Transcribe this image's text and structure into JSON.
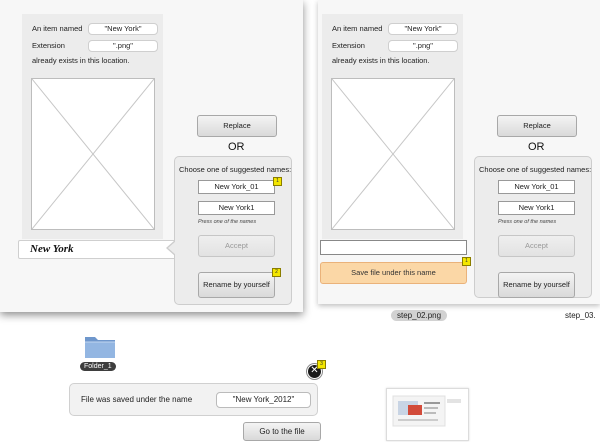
{
  "dialog_left": {
    "item_named_label": "An item named",
    "item_name_value": "\"New York\"",
    "extension_label": "Extension",
    "extension_value": "\".png\"",
    "exists_text": "already exists in this location.",
    "replace_button": "Replace",
    "or_text": "OR",
    "suggest_title": "Choose one of suggested names:",
    "suggestions": [
      "New York_01",
      "New York1"
    ],
    "hint_text": "Press one of the names",
    "accept_button": "Accept",
    "rename_button": "Rename by yourself",
    "name_field_value": "New York",
    "marker_1": "1",
    "marker_2": "2"
  },
  "dialog_right": {
    "item_named_label": "An item named",
    "item_name_value": "\"New York\"",
    "extension_label": "Extension",
    "extension_value": "\".png\"",
    "exists_text": "already exists in this location.",
    "replace_button": "Replace",
    "or_text": "OR",
    "suggest_title": "Choose one of suggested names:",
    "suggestions": [
      "New York_01",
      "New York1"
    ],
    "hint_text": "Press one of the names",
    "accept_button": "Accept",
    "rename_button": "Rename by yourself",
    "save_button": "Save file under this name",
    "marker_1": "1"
  },
  "captions": {
    "step_02": "step_02.png",
    "step_03": "step_03."
  },
  "bottom": {
    "folder_label": "Folder_1",
    "saved_text": "File was saved under the name",
    "saved_name": "\"New York_2012\"",
    "goto_button": "Go to the file",
    "close_symbol": "✕",
    "marker_3": "3"
  },
  "colors": {
    "save_button_bg": "#fbd7a6",
    "marker_yellow": "#f3e600",
    "folder_blue": "#7fa6d6"
  }
}
